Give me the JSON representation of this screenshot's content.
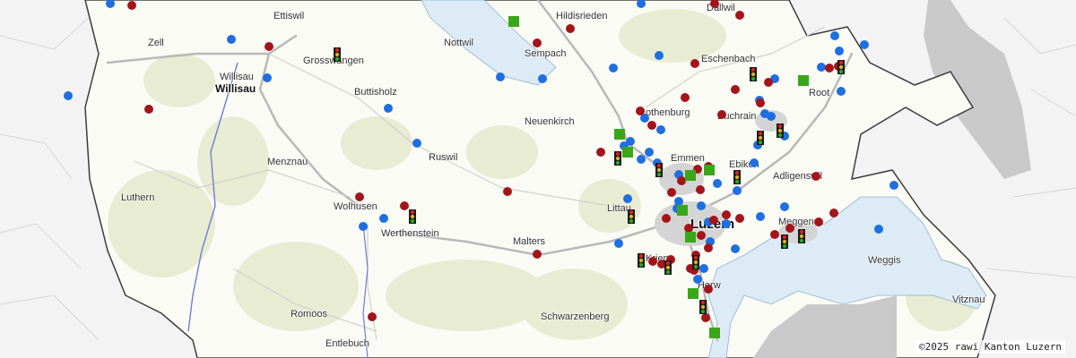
{
  "map": {
    "copyright": "©2025 rawi Kanton Luzern",
    "colors": {
      "canton_fill": "#fbfbf6",
      "outside_fill": "#f3f3f3",
      "lake": "#dcebf5",
      "forest": "#e8ecd2",
      "boundary": "#3c3c3c",
      "road": "#b8b8b8",
      "river": "#6b7fcf",
      "marker_blue": "#1e6fe0",
      "marker_red": "#a3151a",
      "marker_green": "#3aa619"
    },
    "places": [
      {
        "name": "Ettiswil",
        "size": "normal"
      },
      {
        "name": "Zell",
        "size": "normal"
      },
      {
        "name": "Grosswangen",
        "size": "normal"
      },
      {
        "name": "Willisau",
        "size": "normal"
      },
      {
        "name": "Willisau",
        "size": "big"
      },
      {
        "name": "Buttisholz",
        "size": "normal"
      },
      {
        "name": "Nottwil",
        "size": "normal"
      },
      {
        "name": "Hildisrieden",
        "size": "normal"
      },
      {
        "name": "Sempach",
        "size": "normal"
      },
      {
        "name": "Dallwil",
        "size": "normal"
      },
      {
        "name": "Eschenbach",
        "size": "normal"
      },
      {
        "name": "Root",
        "size": "normal"
      },
      {
        "name": "Neuenkirch",
        "size": "normal"
      },
      {
        "name": "Rothenburg",
        "size": "normal"
      },
      {
        "name": "Buchrain",
        "size": "normal"
      },
      {
        "name": "Menznau",
        "size": "normal"
      },
      {
        "name": "Ruswil",
        "size": "normal"
      },
      {
        "name": "Emmen",
        "size": "normal"
      },
      {
        "name": "Ebikon",
        "size": "normal"
      },
      {
        "name": "Adligenswil",
        "size": "normal"
      },
      {
        "name": "Luthern",
        "size": "normal"
      },
      {
        "name": "Wolhusen",
        "size": "normal"
      },
      {
        "name": "Werthenstein",
        "size": "normal"
      },
      {
        "name": "Littau",
        "size": "normal"
      },
      {
        "name": "Luzern",
        "size": "city"
      },
      {
        "name": "Meggen",
        "size": "normal"
      },
      {
        "name": "Malters",
        "size": "normal"
      },
      {
        "name": "Weggis",
        "size": "normal"
      },
      {
        "name": "Kriens",
        "size": "normal"
      },
      {
        "name": "Horw",
        "size": "normal"
      },
      {
        "name": "Vitznau",
        "size": "normal"
      },
      {
        "name": "Romoos",
        "size": "normal"
      },
      {
        "name": "Schwarzenberg",
        "size": "normal"
      },
      {
        "name": "Entlebuch",
        "size": "normal"
      }
    ],
    "marker_types": [
      "blue-dot-marker",
      "red-dot-marker",
      "green-square-marker",
      "traffic-light-marker"
    ]
  }
}
